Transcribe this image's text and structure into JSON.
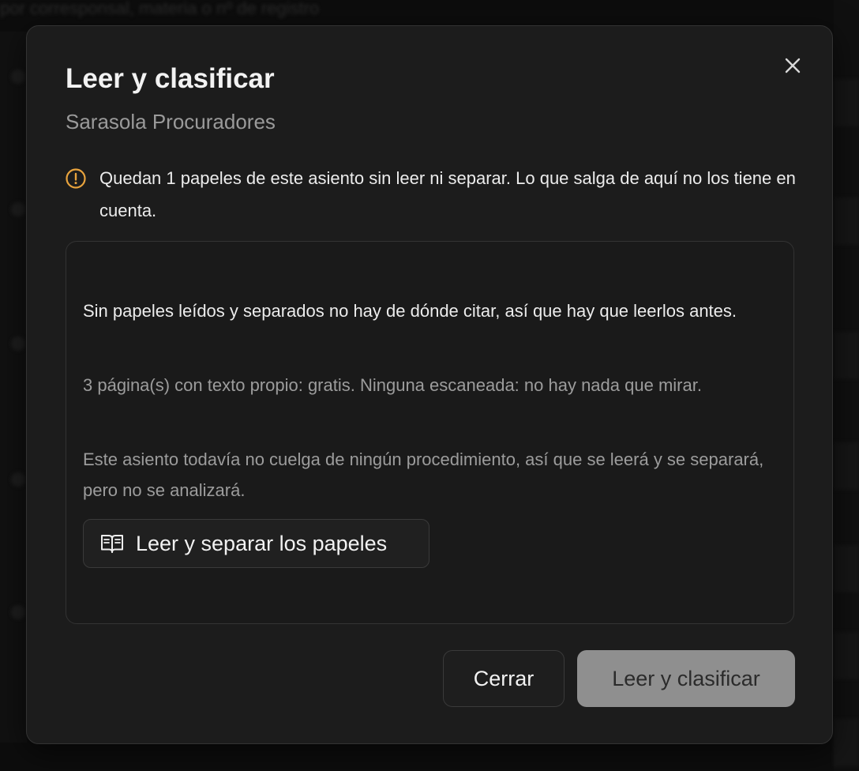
{
  "background": {
    "top_text": "por corresponsal, materia o nº de registro"
  },
  "dialog": {
    "title": "Leer y clasificar",
    "subtitle": "Sarasola Procuradores",
    "warning": "Quedan 1 papeles de este asiento sin leer ni separar. Lo que salga de aquí no los tiene en cuenta.",
    "card": {
      "main_text": "Sin papeles leídos y separados no hay de dónde citar, así que hay que leerlos antes.",
      "note_pages": "3 página(s) con texto propio: gratis. Ninguna escaneada: no hay nada que mirar.",
      "note_procedure": "Este asiento todavía no cuelga de ningún procedimiento, así que se leerá y se separará, pero no se analizará.",
      "read_button_label": "Leer y separar los papeles"
    },
    "buttons": {
      "close_label": "Cerrar",
      "primary_label": "Leer y clasificar"
    }
  },
  "icons": {
    "close": "close-icon",
    "warning": "alert-circle-icon",
    "book": "book-open-icon"
  },
  "colors": {
    "warning": "#e8a33d",
    "primary_disabled_bg": "#8f8f8f",
    "dialog_bg": "#1c1c1c"
  }
}
